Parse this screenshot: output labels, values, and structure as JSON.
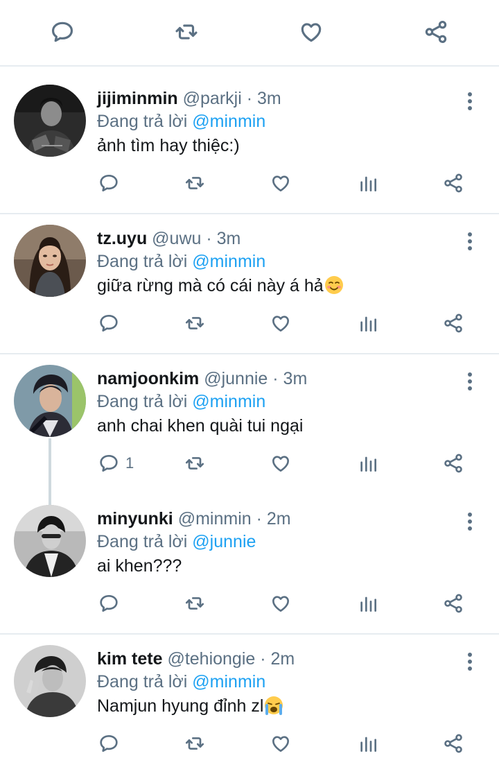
{
  "top_actions": [
    {
      "name": "reply-icon"
    },
    {
      "name": "retweet-icon"
    },
    {
      "name": "like-icon"
    },
    {
      "name": "share-icon"
    }
  ],
  "replies": [
    {
      "display_name": "jijiminmin",
      "handle": "@parkji",
      "time": "· 3m",
      "replying_label": "Đang trả lời",
      "replying_to": "@minmin",
      "text": "ảnh tìm hay thiệc:)",
      "emoji": "",
      "reply_count": ""
    },
    {
      "display_name": "tz.uyu",
      "handle": "@uwu",
      "time": "· 3m",
      "replying_label": "Đang trả lời",
      "replying_to": "@minmin",
      "text": "giữa rừng mà có cái này á hả",
      "emoji": "smiling-face-icon",
      "reply_count": ""
    },
    {
      "display_name": "namjoonkim",
      "handle": "@junnie",
      "time": "· 3m",
      "replying_label": "Đang trả lời",
      "replying_to": "@minmin",
      "text": "anh chai khen quài tui ngại",
      "emoji": "",
      "reply_count": "1"
    },
    {
      "display_name": "minyunki",
      "handle": "@minmin",
      "time": "· 2m",
      "replying_label": "Đang trả lời",
      "replying_to": "@junnie",
      "text": "ai khen???",
      "emoji": "",
      "reply_count": ""
    },
    {
      "display_name": "kim tete",
      "handle": "@tehiongie",
      "time": "· 2m",
      "replying_label": "Đang trả lời",
      "replying_to": "@minmin",
      "text": "Namjun hyung đỉnh zl",
      "emoji": "crying-face-icon",
      "reply_count": ""
    }
  ],
  "colors": {
    "accent": "#1da1f2",
    "secondary_text": "#5b7083",
    "divider": "#e6ecf0",
    "thread_line": "#cfd9de"
  }
}
